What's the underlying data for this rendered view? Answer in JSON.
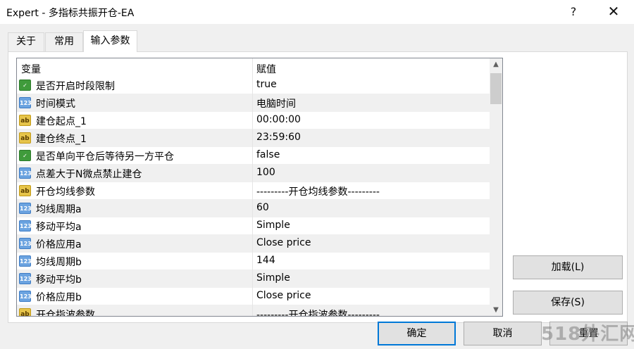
{
  "window": {
    "title": "Expert - 多指标共振开仓-EA",
    "help_glyph": "?",
    "close_glyph": "✕"
  },
  "tabs": [
    {
      "label": "关于"
    },
    {
      "label": "常用"
    },
    {
      "label": "输入参数"
    }
  ],
  "grid": {
    "headers": {
      "variable": "变量",
      "value": "赋值"
    },
    "rows": [
      {
        "type": "bool",
        "name": "是否开启时段限制",
        "value": "true"
      },
      {
        "type": "num",
        "name": "时间模式",
        "value": "电脑时间"
      },
      {
        "type": "str",
        "name": "建仓起点_1",
        "value": "00:00:00"
      },
      {
        "type": "str",
        "name": "建仓终点_1",
        "value": "23:59:60"
      },
      {
        "type": "bool",
        "name": "是否单向平仓后等待另一方平仓",
        "value": "false"
      },
      {
        "type": "num",
        "name": "点差大于N微点禁止建仓",
        "value": "100"
      },
      {
        "type": "str",
        "name": "开仓均线参数",
        "value": "---------开仓均线参数---------"
      },
      {
        "type": "num",
        "name": "均线周期a",
        "value": "60"
      },
      {
        "type": "num",
        "name": "移动平均a",
        "value": "Simple"
      },
      {
        "type": "num",
        "name": "价格应用a",
        "value": "Close price"
      },
      {
        "type": "num",
        "name": "均线周期b",
        "value": "144"
      },
      {
        "type": "num",
        "name": "移动平均b",
        "value": "Simple"
      },
      {
        "type": "num",
        "name": "价格应用b",
        "value": "Close price"
      },
      {
        "type": "str",
        "name": "开仓指波参数",
        "value": "---------开仓指波参数---------"
      }
    ],
    "icon_text": {
      "bool": "✓",
      "num": "123",
      "str": "ab"
    }
  },
  "buttons": {
    "load": "加载(L)",
    "save": "保存(S)",
    "ok": "确定",
    "cancel": "取消",
    "reset": "重置"
  },
  "scroll": {
    "up": "▲",
    "down": "▼"
  },
  "watermark": "518外汇网"
}
